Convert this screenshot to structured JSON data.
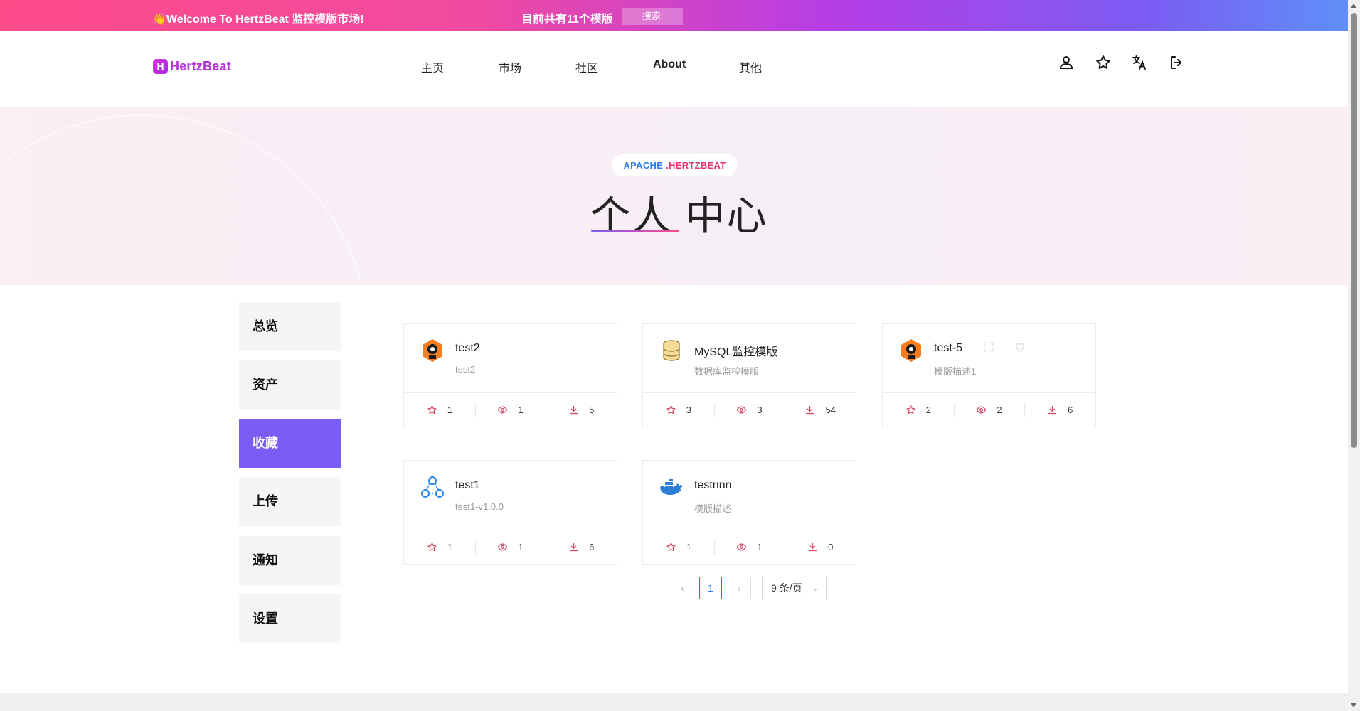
{
  "banner": {
    "welcome": "👋Welcome To HertzBeat 监控模版市场!",
    "count_text": "目前共有11个模版",
    "search_label": "搜索!"
  },
  "header": {
    "logo_mark": "H",
    "logo_text": "HertzBeat",
    "nav": [
      "主页",
      "市场",
      "社区",
      "About",
      "其他"
    ],
    "icons": [
      "user-icon",
      "star-icon",
      "translate-icon",
      "logout-icon"
    ]
  },
  "hero": {
    "tag_part1": "APACHE ",
    "tag_part2": ".HERTZBEAT",
    "title": "个人 中心"
  },
  "sidebar": {
    "items": [
      "总览",
      "资产",
      "收藏",
      "上传",
      "通知",
      "设置"
    ],
    "active_index": 2
  },
  "cards": [
    {
      "title": "test2",
      "desc": "test2",
      "icon": "prometheus-icon",
      "stars": "1",
      "views": "1",
      "downloads": "5"
    },
    {
      "title": "MySQL监控模版",
      "desc": "数据库监控模版",
      "icon": "database-icon",
      "stars": "3",
      "views": "3",
      "downloads": "54"
    },
    {
      "title": "test-5",
      "desc": "模版描述1",
      "icon": "prometheus-icon",
      "stars": "2",
      "views": "2",
      "downloads": "6"
    },
    {
      "title": "test1",
      "desc": "test1-v1.0.0",
      "icon": "cluster-icon",
      "stars": "1",
      "views": "1",
      "downloads": "6"
    },
    {
      "title": "testnnn",
      "desc": "模版描述",
      "icon": "docker-icon",
      "stars": "1",
      "views": "1",
      "downloads": "0"
    }
  ],
  "pagination": {
    "current_page": "1",
    "page_size_label": "9 条/页"
  },
  "colors": {
    "accent": "#7b5cf6",
    "stat_icon": "#d4455f",
    "page_active": "#1677ff"
  }
}
